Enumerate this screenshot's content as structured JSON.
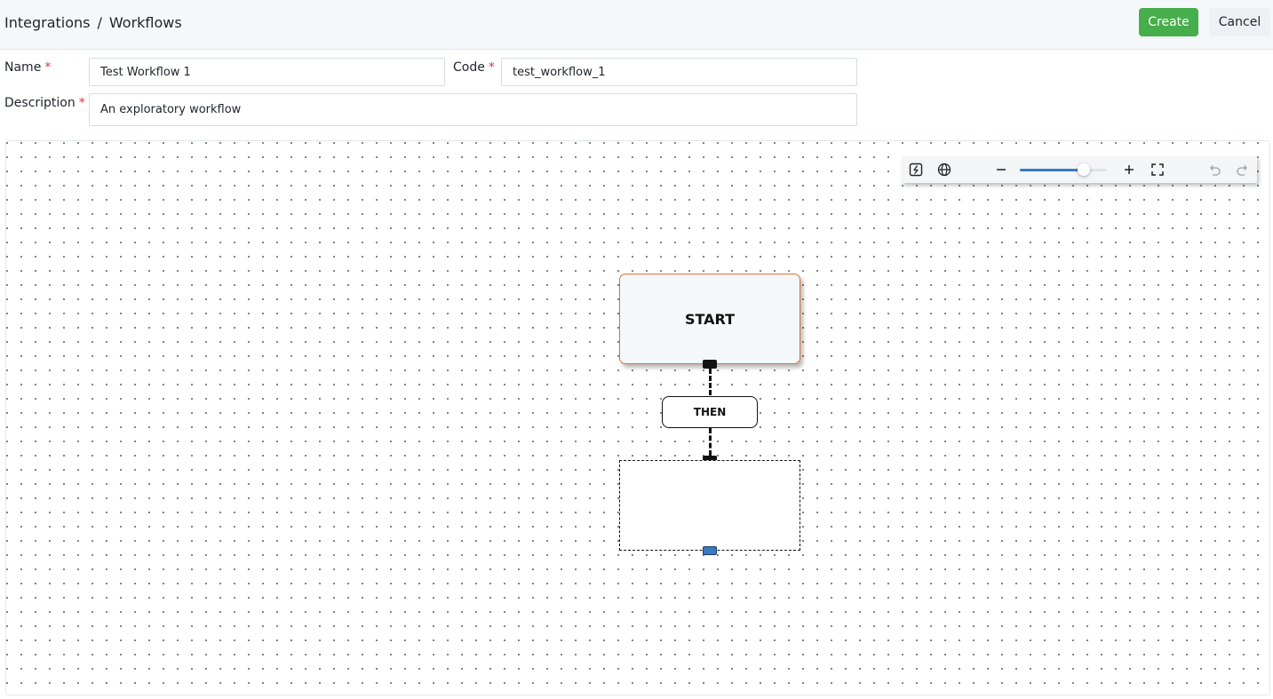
{
  "breadcrumb": {
    "items": [
      "Integrations",
      "Workflows"
    ],
    "separator": "/"
  },
  "header": {
    "create_label": "Create",
    "cancel_label": "Cancel"
  },
  "form": {
    "name": {
      "label": "Name",
      "required_mark": "*",
      "value": "Test Workflow 1"
    },
    "code": {
      "label": "Code",
      "required_mark": "*",
      "value": "test_workflow_1"
    },
    "description": {
      "label": "Description",
      "required_mark": "*",
      "value": "An exploratory workflow"
    }
  },
  "toolbar": {
    "icons": [
      "function-icon",
      "globe-icon",
      "zoom-out-icon",
      "zoom-in-icon",
      "fit-view-icon",
      "undo-icon",
      "redo-icon"
    ],
    "zoom_fraction": 0.73
  },
  "workflow": {
    "start_label": "START",
    "connector_label": "THEN"
  },
  "colors": {
    "create_button": "#46ae4b",
    "start_border": "#e0702a",
    "accent": "#3a78c7",
    "required": "#d9363e"
  }
}
